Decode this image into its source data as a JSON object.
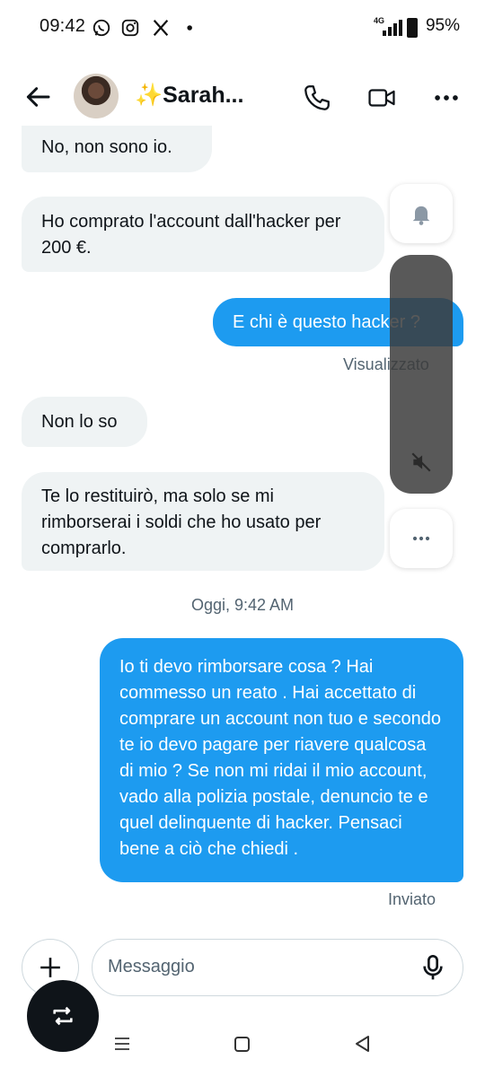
{
  "status_bar": {
    "time": "09:42",
    "network": "4G",
    "battery": "95%",
    "icons": [
      "whatsapp-icon",
      "instagram-icon",
      "x-icon",
      "dot-icon"
    ]
  },
  "header": {
    "contact_name": "✨Sarah...",
    "icons": [
      "back-arrow-icon",
      "phone-icon",
      "video-icon",
      "more-icon"
    ]
  },
  "messages": [
    {
      "direction": "in",
      "text": "No, non sono io."
    },
    {
      "direction": "in",
      "text": "Ho comprato l'account dall'hacker per 200 €."
    },
    {
      "direction": "out",
      "text": "E chi è questo hacker ?",
      "status": "Visualizzato"
    },
    {
      "direction": "in",
      "text": "Non lo so"
    },
    {
      "direction": "in",
      "text": "Te lo restituirò, ma solo se mi rimborserai i soldi che ho usato per comprarlo."
    },
    {
      "direction": "divider",
      "text": "Oggi, 9:42 AM"
    },
    {
      "direction": "out",
      "text": "Io ti devo rimborsare cosa ? Hai commesso un reato . Hai accettato di comprare un account non tuo e secondo te io devo pagare per riavere qualcosa di mio ? Se non mi ridai il mio account, vado alla polizia postale, denuncio te e quel delinquente di hacker. Pensaci bene a ciò che chiedi .",
      "status": "Inviato"
    }
  ],
  "composer": {
    "placeholder": "Messaggio"
  },
  "overlay_icons": [
    "bell-icon",
    "mute-icon",
    "more-horizontal-icon"
  ],
  "nav_icons": [
    "recent-apps-icon",
    "home-icon",
    "back-icon"
  ],
  "colors": {
    "accent": "#1d9bf0",
    "incoming_bg": "#eff3f4",
    "text": "#0f1419",
    "muted": "#536471"
  }
}
